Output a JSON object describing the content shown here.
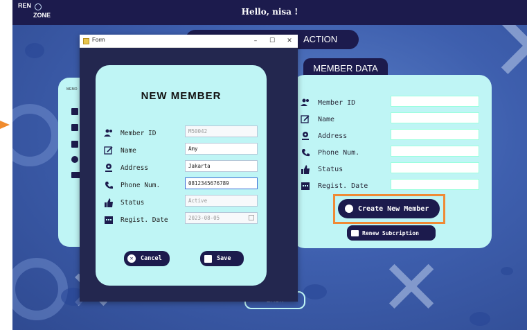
{
  "app": {
    "greeting": "Hello, nisa !",
    "logo_top": "REN",
    "logo_bottom": "ZONE"
  },
  "section": {
    "title": "ACTION"
  },
  "member_data": {
    "tab_label": "MEMBER DATA",
    "fields": [
      {
        "label": "Member ID",
        "icon": "user-icon"
      },
      {
        "label": "Name",
        "icon": "edit-icon"
      },
      {
        "label": "Address",
        "icon": "location-icon"
      },
      {
        "label": "Phone Num.",
        "icon": "phone-icon"
      },
      {
        "label": "Status",
        "icon": "thumbs-up-icon"
      },
      {
        "label": "Regist. Date",
        "icon": "calendar-icon"
      }
    ],
    "create_button": "Create New Member",
    "renew_button": "Renew Subcription"
  },
  "left_panel": {
    "label": "MEMO"
  },
  "back_button": "BACK",
  "form_window": {
    "title": "Form",
    "controls": [
      "–",
      "☐",
      "✕"
    ],
    "heading": "NEW MEMBER",
    "fields": [
      {
        "label": "Member ID",
        "value": "M50042",
        "icon": "user-icon"
      },
      {
        "label": "Name",
        "value": "Amy",
        "icon": "edit-icon"
      },
      {
        "label": "Address",
        "value": "Jakarta",
        "icon": "location-icon"
      },
      {
        "label": "Phone Num.",
        "value": "0812345676789",
        "icon": "phone-icon"
      },
      {
        "label": "Status",
        "value": "Active",
        "icon": "thumbs-up-icon"
      },
      {
        "label": "Regist. Date",
        "value": "2023-08-05",
        "icon": "calendar-icon"
      }
    ],
    "cancel_button": "Cancel",
    "save_button": "Save"
  },
  "colors": {
    "navy": "#1c1b4d",
    "card": "#bff5f5",
    "highlight": "#ef8a35",
    "background": "#3e5fae"
  }
}
